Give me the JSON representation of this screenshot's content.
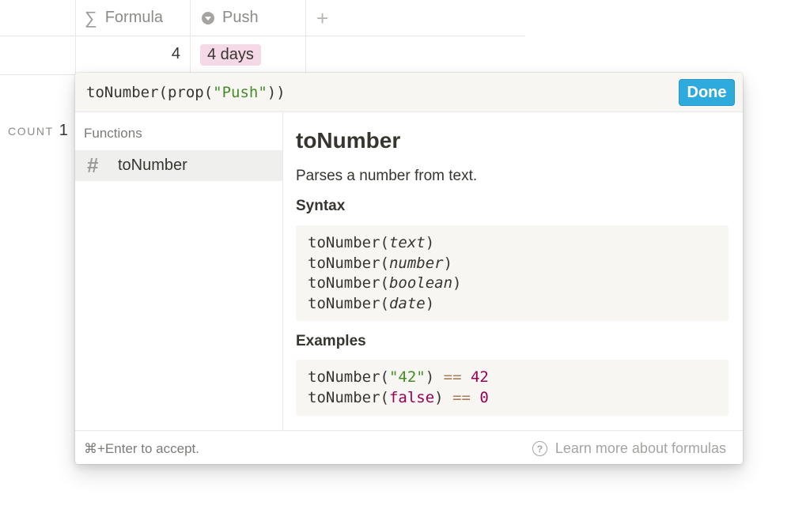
{
  "table": {
    "columns": [
      {
        "icon": "sigma-icon",
        "label": "Formula"
      },
      {
        "icon": "select-icon",
        "label": "Push"
      }
    ],
    "add_icon": "plus-icon",
    "rows": [
      {
        "formula_value": "4",
        "push_value": "4 days"
      }
    ],
    "count_label": "COUNT",
    "count_value": "1",
    "colors": {
      "badge": "#f5d9e7"
    }
  },
  "popup": {
    "expression": {
      "before": "toNumber(prop(",
      "string": "\"Push\"",
      "after": "))"
    },
    "done_label": "Done",
    "section_label": "Functions",
    "function_item": {
      "icon": "hash-icon",
      "label": "toNumber"
    },
    "doc": {
      "title": "toNumber",
      "description": "Parses a number from text.",
      "syntax_heading": "Syntax",
      "syntax": [
        {
          "fn": "toNumber(",
          "arg": "text",
          "close": ")"
        },
        {
          "fn": "toNumber(",
          "arg": "number",
          "close": ")"
        },
        {
          "fn": "toNumber(",
          "arg": "boolean",
          "close": ")"
        },
        {
          "fn": "toNumber(",
          "arg": "date",
          "close": ")"
        }
      ],
      "examples_heading": "Examples",
      "examples": [
        {
          "fn": "toNumber(",
          "arg": "\"42\"",
          "close": ")",
          "op": "==",
          "result": "42"
        },
        {
          "fn": "toNumber(",
          "arg": "false",
          "close": ")",
          "op": "==",
          "result": "0"
        }
      ]
    },
    "footer": {
      "hint": "⌘+Enter to accept.",
      "learn_icon": "question-icon",
      "learn_label": "Learn more about formulas"
    },
    "colors": {
      "accent": "#2eaadc",
      "string": "#448c27",
      "operator": "#a67f59",
      "literal": "#990055"
    }
  }
}
